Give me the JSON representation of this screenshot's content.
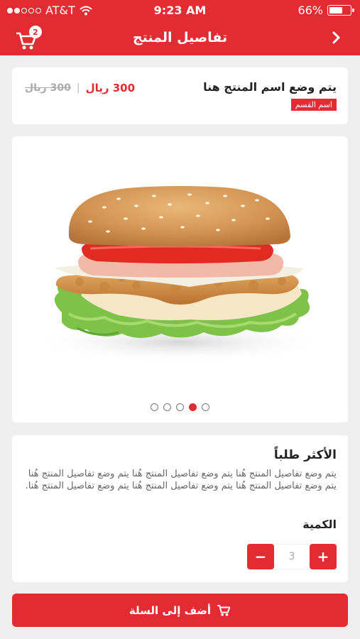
{
  "status_bar": {
    "carrier": "AT&T",
    "time": "9:23 AM",
    "battery": "66%",
    "battery_level": 0.66,
    "signal_bars_filled": 2,
    "signal_bars_total": 5
  },
  "header": {
    "title": "تفاصيل المنتج",
    "cart_count": "2",
    "back_icon": "chevron-right-icon",
    "cart_icon": "cart-icon"
  },
  "product": {
    "name": "يتم وضع اسم المنتج هنا",
    "category": "اسم القسم",
    "price": "300 ريال",
    "old_price": "300 ريال",
    "image": "chicken-burger",
    "image_pages": 5,
    "image_active_page": 4
  },
  "details": {
    "section_title": "الأكثر طلباً",
    "description": "يتم وضع تفاصيل المنتج هُنا يتم وضع تفاصيل المنتج هُنا يتم وضع تفاصيل المنتج هُنا يتم وضع تفاصيل المنتج هُنا يتم وضع تفاصيل المنتج هُنا يتم وضع تفاصيل المنتج هُنا.",
    "quantity_label": "الكمية",
    "quantity_value": "3",
    "minus_label": "−",
    "plus_label": "+"
  },
  "actions": {
    "add_to_cart": "أضف إلى السلة"
  },
  "colors": {
    "brand": "#e32b33",
    "background": "#efefef"
  }
}
